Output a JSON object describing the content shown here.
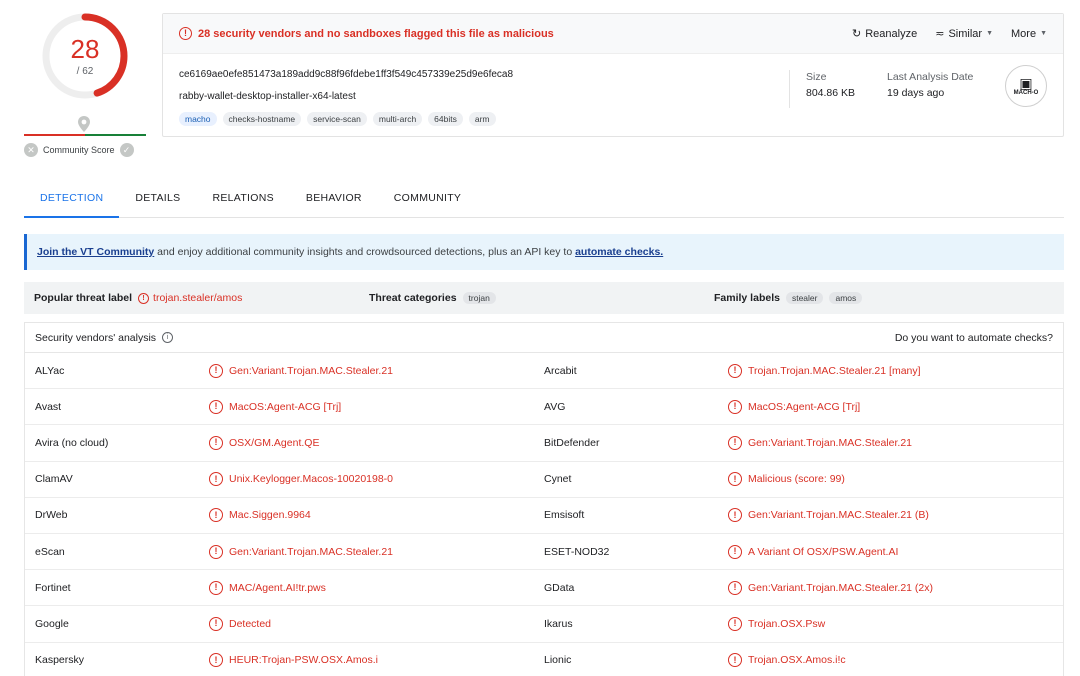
{
  "score": {
    "detections": "28",
    "total": "/ 62",
    "community_label": "Community Score",
    "colors": {
      "malicious": "#d93025",
      "harmless": "#188038"
    }
  },
  "alert": {
    "text": "28 security vendors and no sandboxes flagged this file as malicious"
  },
  "actions": {
    "reanalyze": "Reanalyze",
    "similar": "Similar",
    "more": "More"
  },
  "file": {
    "hash": "ce6169ae0efe851473a189add9c88f96fdebe1ff3f549c457339e25d9e6feca8",
    "name": "rabby-wallet-desktop-installer-x64-latest",
    "tags": [
      "macho",
      "checks-hostname",
      "service-scan",
      "multi-arch",
      "64bits",
      "arm"
    ],
    "size_label": "Size",
    "size_value": "804.86 KB",
    "last_analysis_label": "Last Analysis Date",
    "last_analysis_value": "19 days ago",
    "type_icon_label": "MACH-O"
  },
  "tabs": [
    "DETECTION",
    "DETAILS",
    "RELATIONS",
    "BEHAVIOR",
    "COMMUNITY"
  ],
  "banner": {
    "link": "Join the VT Community",
    "text": " and enjoy additional community insights and crowdsourced detections, plus an API key to ",
    "link2": "automate checks."
  },
  "threat": {
    "popular_label": "Popular threat label",
    "popular_value": "trojan.stealer/amos",
    "categories_label": "Threat categories",
    "categories": [
      "trojan"
    ],
    "family_label": "Family labels",
    "families": [
      "stealer",
      "amos"
    ]
  },
  "vendors_header": {
    "title": "Security vendors' analysis",
    "ask": "Do you want to automate checks?"
  },
  "vendor_rows": [
    [
      {
        "name": "ALYac",
        "result": "Gen:Variant.Trojan.MAC.Stealer.21"
      },
      {
        "name": "Arcabit",
        "result": "Trojan.Trojan.MAC.Stealer.21 [many]"
      }
    ],
    [
      {
        "name": "Avast",
        "result": "MacOS:Agent-ACG [Trj]"
      },
      {
        "name": "AVG",
        "result": "MacOS:Agent-ACG [Trj]"
      }
    ],
    [
      {
        "name": "Avira (no cloud)",
        "result": "OSX/GM.Agent.QE"
      },
      {
        "name": "BitDefender",
        "result": "Gen:Variant.Trojan.MAC.Stealer.21"
      }
    ],
    [
      {
        "name": "ClamAV",
        "result": "Unix.Keylogger.Macos-10020198-0"
      },
      {
        "name": "Cynet",
        "result": "Malicious (score: 99)"
      }
    ],
    [
      {
        "name": "DrWeb",
        "result": "Mac.Siggen.9964"
      },
      {
        "name": "Emsisoft",
        "result": "Gen:Variant.Trojan.MAC.Stealer.21 (B)"
      }
    ],
    [
      {
        "name": "eScan",
        "result": "Gen:Variant.Trojan.MAC.Stealer.21"
      },
      {
        "name": "ESET-NOD32",
        "result": "A Variant Of OSX/PSW.Agent.AI"
      }
    ],
    [
      {
        "name": "Fortinet",
        "result": "MAC/Agent.AI!tr.pws"
      },
      {
        "name": "GData",
        "result": "Gen:Variant.Trojan.MAC.Stealer.21 (2x)"
      }
    ],
    [
      {
        "name": "Google",
        "result": "Detected"
      },
      {
        "name": "Ikarus",
        "result": "Trojan.OSX.Psw"
      }
    ],
    [
      {
        "name": "Kaspersky",
        "result": "HEUR:Trojan-PSW.OSX.Amos.i"
      },
      {
        "name": "Lionic",
        "result": "Trojan.OSX.Amos.i!c"
      }
    ]
  ]
}
